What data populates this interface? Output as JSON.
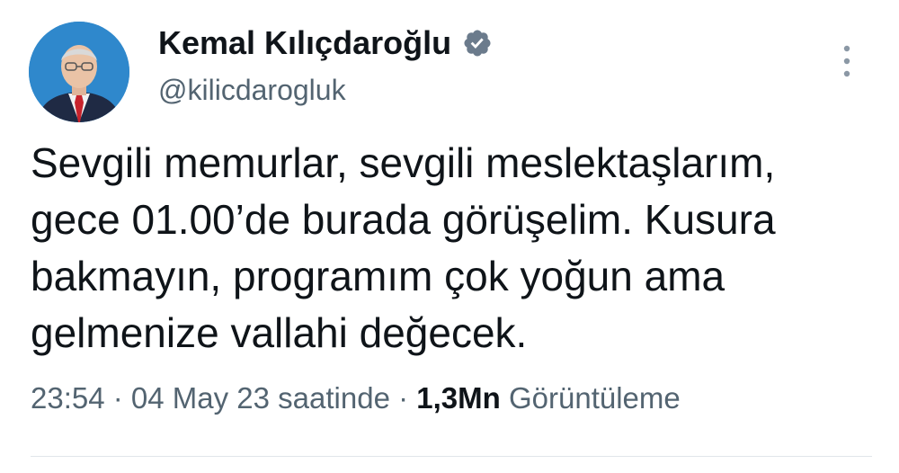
{
  "author": {
    "display_name": "Kemal Kılıçdaroğlu",
    "handle": "@kilicdarogluk",
    "verified": true,
    "verified_color": "#6b7b8c"
  },
  "tweet": {
    "text": "Sevgili memurlar, sevgili meslektaşlarım,\ngece 01.00’de burada görüşelim. Kusura\nbakmayın, programım çok yoğun ama\ngelmenize vallahi değecek."
  },
  "meta": {
    "time": "23:54",
    "separator": " · ",
    "date": "04 May 23 saatinde",
    "views_count": "1,3Mn",
    "views_label": "Görüntüleme"
  },
  "icons": {
    "verified": "verified-badge-icon",
    "more": "more-options-icon"
  }
}
